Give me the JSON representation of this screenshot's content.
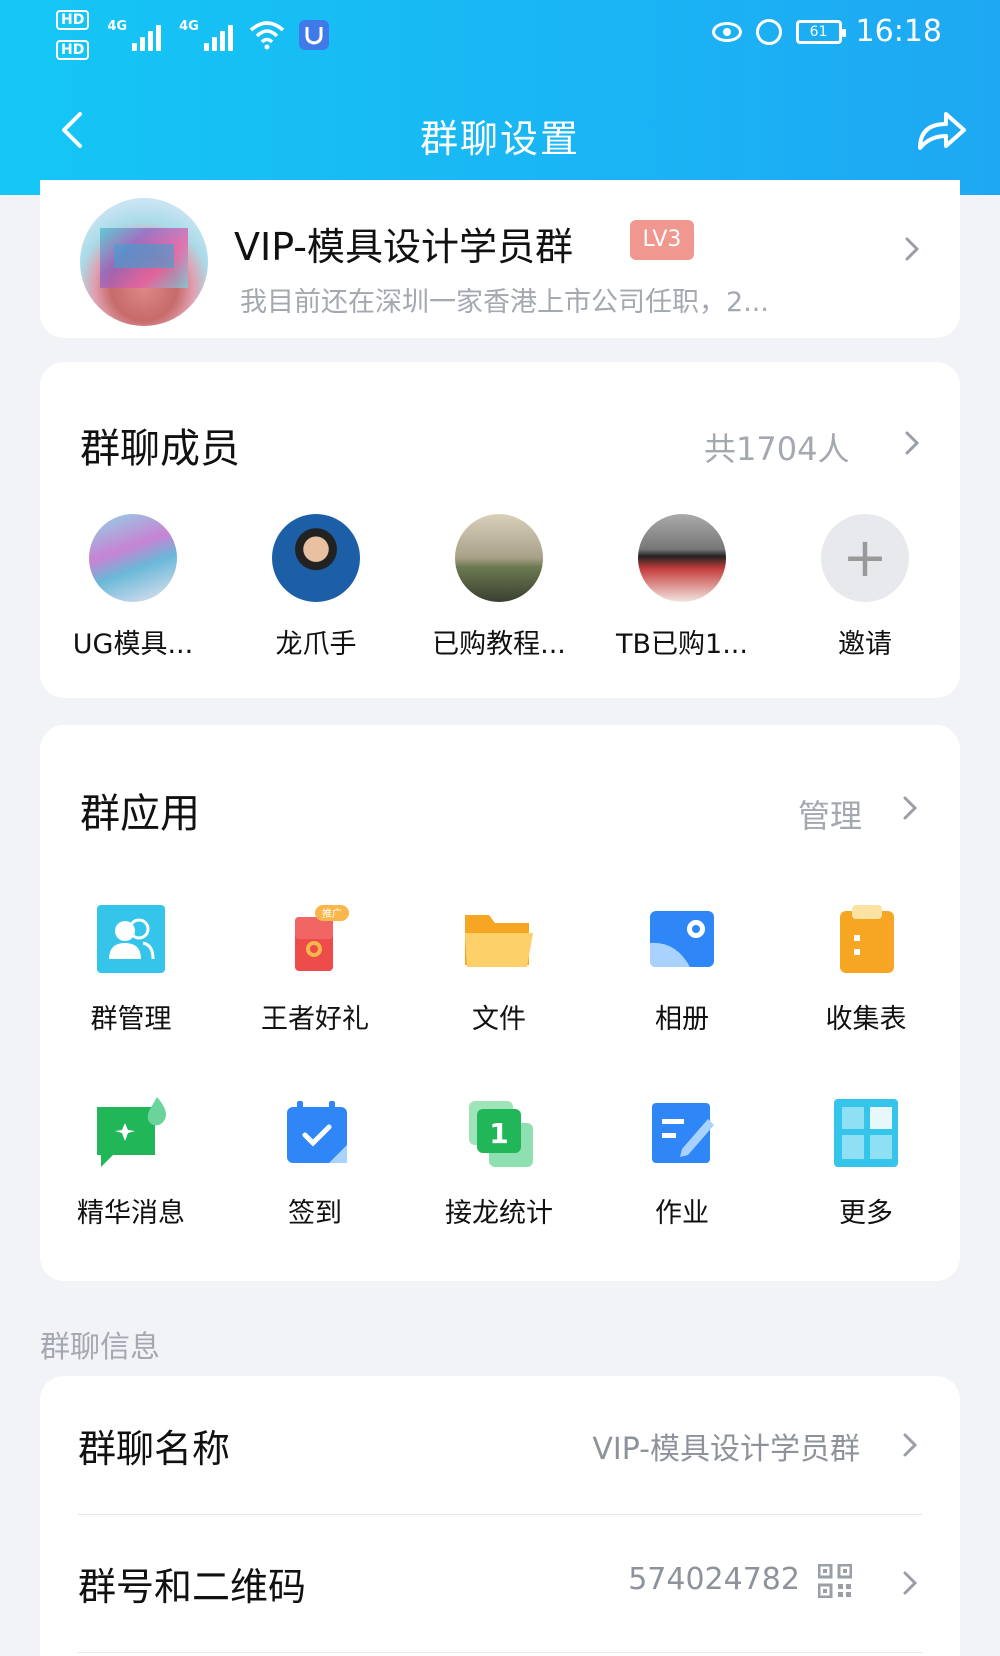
{
  "status_bar": {
    "hd1": "HD",
    "hd2": "HD",
    "net1": "4G",
    "net2": "4G",
    "battery": "61",
    "time": "16:18"
  },
  "nav": {
    "title": "群聊设置"
  },
  "group": {
    "name": "VIP-模具设计学员群",
    "level": "LV3",
    "description": "我目前还在深圳一家香港上市公司任职，2..."
  },
  "members": {
    "title": "群聊成员",
    "count": "共1704人",
    "list": [
      {
        "name": "UG模具..."
      },
      {
        "name": "龙爪手"
      },
      {
        "name": "已购教程..."
      },
      {
        "name": "TB已购1..."
      }
    ],
    "invite": "邀请"
  },
  "apps": {
    "title": "群应用",
    "manage": "管理",
    "promo_tag": "推广",
    "items": [
      {
        "label": "群管理",
        "icon": "group-manage-icon"
      },
      {
        "label": "王者好礼",
        "icon": "gift-icon"
      },
      {
        "label": "文件",
        "icon": "folder-icon"
      },
      {
        "label": "相册",
        "icon": "album-icon"
      },
      {
        "label": "收集表",
        "icon": "clipboard-icon"
      },
      {
        "label": "精华消息",
        "icon": "essence-message-icon"
      },
      {
        "label": "签到",
        "icon": "check-in-icon"
      },
      {
        "label": "接龙统计",
        "icon": "relay-stats-icon"
      },
      {
        "label": "作业",
        "icon": "homework-icon"
      },
      {
        "label": "更多",
        "icon": "more-grid-icon"
      }
    ]
  },
  "info": {
    "section_label": "群聊信息",
    "group_name_key": "群聊名称",
    "group_name_value": "VIP-模具设计学员群",
    "group_number_key": "群号和二维码",
    "group_number_value": "574024782"
  },
  "colors": {
    "header_start": "#14c7f5",
    "header_end": "#1ea8f3",
    "background": "#f2f3f7",
    "secondary_text": "#a4a8b0",
    "level_badge": "#f09890"
  }
}
